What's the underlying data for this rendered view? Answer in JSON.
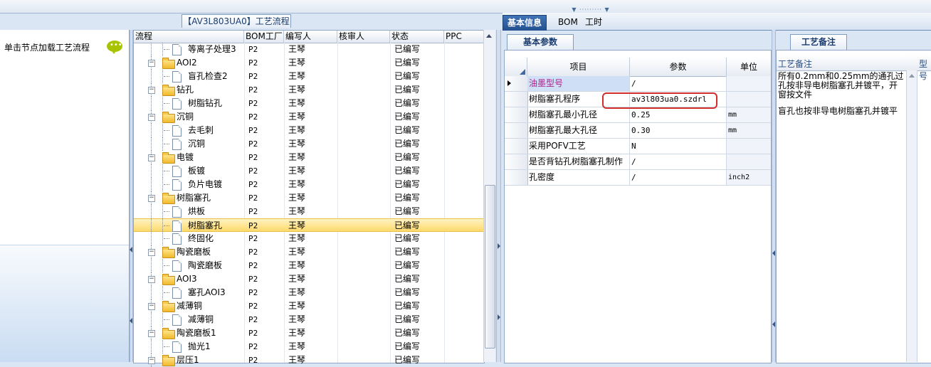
{
  "left": {
    "hint": "单击节点加载工艺流程"
  },
  "middle": {
    "title": "【AV3L803UA0】工艺流程",
    "columns": [
      "流程",
      "BOM工厂",
      "编写人",
      "核审人",
      "状态",
      "PPC"
    ],
    "rows": [
      {
        "level": 2,
        "type": "doc",
        "name": "等离子处理3",
        "bom": "P2",
        "author": "王琴",
        "reviewer": "",
        "status": "已编写"
      },
      {
        "level": 1,
        "type": "folder",
        "name": "AOI2",
        "bom": "P2",
        "author": "王琴",
        "reviewer": "",
        "status": "已编写"
      },
      {
        "level": 2,
        "type": "doc",
        "name": "盲孔检查2",
        "bom": "P2",
        "author": "王琴",
        "reviewer": "",
        "status": "已编写"
      },
      {
        "level": 1,
        "type": "folder",
        "name": "钻孔",
        "bom": "P2",
        "author": "王琴",
        "reviewer": "",
        "status": "已编写"
      },
      {
        "level": 2,
        "type": "doc",
        "name": "树脂钻孔",
        "bom": "P2",
        "author": "王琴",
        "reviewer": "",
        "status": "已编写"
      },
      {
        "level": 1,
        "type": "folder",
        "name": "沉铜",
        "bom": "P2",
        "author": "王琴",
        "reviewer": "",
        "status": "已编写"
      },
      {
        "level": 2,
        "type": "doc",
        "name": "去毛刺",
        "bom": "P2",
        "author": "王琴",
        "reviewer": "",
        "status": "已编写"
      },
      {
        "level": 2,
        "type": "doc",
        "name": "沉铜",
        "bom": "P2",
        "author": "王琴",
        "reviewer": "",
        "status": "已编写"
      },
      {
        "level": 1,
        "type": "folder",
        "name": "电镀",
        "bom": "P2",
        "author": "王琴",
        "reviewer": "",
        "status": "已编写"
      },
      {
        "level": 2,
        "type": "doc",
        "name": "板镀",
        "bom": "P2",
        "author": "王琴",
        "reviewer": "",
        "status": "已编写"
      },
      {
        "level": 2,
        "type": "doc",
        "name": "负片电镀",
        "bom": "P2",
        "author": "王琴",
        "reviewer": "",
        "status": "已编写"
      },
      {
        "level": 1,
        "type": "folder",
        "name": "树脂塞孔",
        "bom": "P2",
        "author": "王琴",
        "reviewer": "",
        "status": "已编写"
      },
      {
        "level": 2,
        "type": "doc",
        "name": "烘板",
        "bom": "P2",
        "author": "王琴",
        "reviewer": "",
        "status": "已编写"
      },
      {
        "level": 2,
        "type": "doc",
        "name": "树脂塞孔",
        "bom": "P2",
        "author": "王琴",
        "reviewer": "",
        "status": "已编写",
        "selected": true
      },
      {
        "level": 2,
        "type": "doc",
        "name": "终固化",
        "bom": "P2",
        "author": "王琴",
        "reviewer": "",
        "status": "已编写"
      },
      {
        "level": 1,
        "type": "folder",
        "name": "陶瓷磨板",
        "bom": "P2",
        "author": "王琴",
        "reviewer": "",
        "status": "已编写"
      },
      {
        "level": 2,
        "type": "doc",
        "name": "陶瓷磨板",
        "bom": "P2",
        "author": "王琴",
        "reviewer": "",
        "status": "已编写"
      },
      {
        "level": 1,
        "type": "folder",
        "name": "AOI3",
        "bom": "P2",
        "author": "王琴",
        "reviewer": "",
        "status": "已编写"
      },
      {
        "level": 2,
        "type": "doc",
        "name": "塞孔AOI3",
        "bom": "P2",
        "author": "王琴",
        "reviewer": "",
        "status": "已编写"
      },
      {
        "level": 1,
        "type": "folder",
        "name": "减薄铜",
        "bom": "P2",
        "author": "王琴",
        "reviewer": "",
        "status": "已编写"
      },
      {
        "level": 2,
        "type": "doc",
        "name": "减薄铜",
        "bom": "P2",
        "author": "王琴",
        "reviewer": "",
        "status": "已编写"
      },
      {
        "level": 1,
        "type": "folder",
        "name": "陶瓷磨板1",
        "bom": "P2",
        "author": "王琴",
        "reviewer": "",
        "status": "已编写"
      },
      {
        "level": 2,
        "type": "doc",
        "name": "抛光1",
        "bom": "P2",
        "author": "王琴",
        "reviewer": "",
        "status": "已编写"
      },
      {
        "level": 1,
        "type": "folder",
        "name": "层压1",
        "bom": "P2",
        "author": "王琴",
        "reviewer": "",
        "status": "已编写"
      }
    ]
  },
  "right": {
    "tabs": [
      "基本信息",
      "BOM",
      "工时"
    ],
    "subtab": "基本参数",
    "param_columns": [
      "项目",
      "参数",
      "单位"
    ],
    "params": [
      {
        "item": "油墨型号",
        "value": "/",
        "unit": "",
        "item_color": "#b0208c",
        "current": true
      },
      {
        "item": "树脂塞孔程序",
        "value": "av3l803ua0.szdrl",
        "unit": ""
      },
      {
        "item": "树脂塞孔最小孔径",
        "value": "0.25",
        "unit": "mm"
      },
      {
        "item": "树脂塞孔最大孔径",
        "value": "0.30",
        "unit": "mm"
      },
      {
        "item": "采用POFV工艺",
        "value": "N",
        "unit": ""
      },
      {
        "item": "是否背钻孔树脂塞孔制作",
        "value": "/",
        "unit": ""
      },
      {
        "item": "孔密度",
        "value": "/",
        "unit": "inch2"
      }
    ]
  },
  "notes": {
    "tab": "工艺备注",
    "column": "工艺备注",
    "column2": "型号",
    "text1": "所有0.2mm和0.25mm的通孔过孔按非导电树脂塞孔并镀平，开窗按文件",
    "text2": "盲孔也按非导电树脂塞孔并镀平"
  },
  "colors": {
    "selected_row": "#ffd96b",
    "accent": "#234f8e",
    "highlight_border": "#d22e2e"
  }
}
